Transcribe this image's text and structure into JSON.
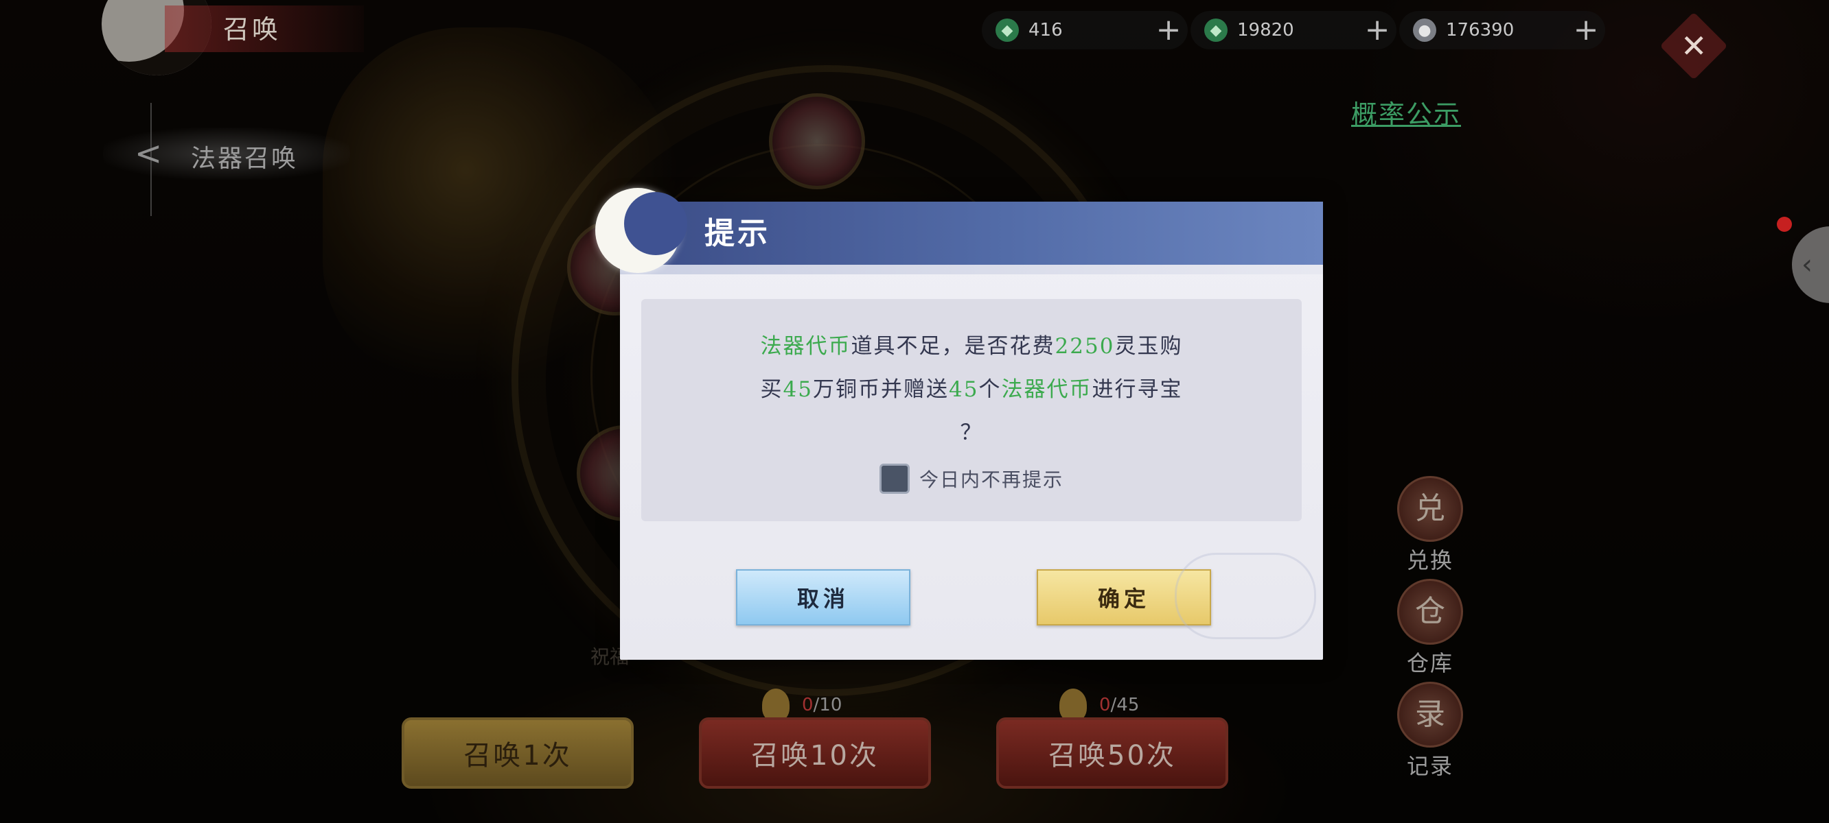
{
  "top_bar": {
    "title": "召唤",
    "currencies": [
      {
        "icon": "jade-icon",
        "value": "416"
      },
      {
        "icon": "jade-icon",
        "value": "19820"
      },
      {
        "icon": "coin-icon",
        "value": "176390"
      }
    ],
    "plus": "+",
    "close": "✕"
  },
  "probability_link": "概率公示",
  "sidebar": {
    "item_label": "法器召唤",
    "arrow": "<"
  },
  "right_tab_arrow": "‹",
  "side_buttons": [
    {
      "label": "兑换",
      "icon": "exchange-icon",
      "glyph": "兑"
    },
    {
      "label": "仓库",
      "icon": "warehouse-icon",
      "glyph": "仓"
    },
    {
      "label": "记录",
      "icon": "record-icon",
      "glyph": "录"
    }
  ],
  "background_text": "祝福",
  "summon": {
    "one": "召唤1次",
    "ten": "召唤10次",
    "fifty": "召唤50次",
    "ten_counter": {
      "current": "0",
      "total": "/10"
    },
    "fifty_counter": {
      "current": "0",
      "total": "/45"
    }
  },
  "dialog": {
    "title": "提示",
    "line1": {
      "p1": "法器代币",
      "p2": "道具不足，是否花费",
      "p3": "2250",
      "p4": "灵玉购"
    },
    "line2": {
      "p1": "买",
      "p2": "45",
      "p3": "万铜币并赠送",
      "p4": "45",
      "p5": "个",
      "p6": "法器代币",
      "p7": "进行寻宝"
    },
    "line3": "？",
    "checkbox_label": "今日内不再提示",
    "cancel": "取消",
    "confirm": "确定"
  },
  "colors": {
    "highlight": "#3caa4e",
    "header": "#536ca8",
    "cancel_button": "#8fc9f0",
    "confirm_button": "#e7c96a"
  }
}
